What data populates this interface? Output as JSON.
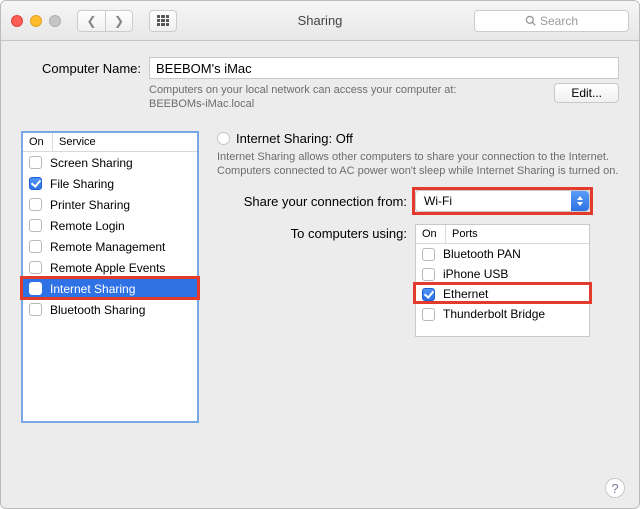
{
  "window": {
    "title": "Sharing",
    "search_placeholder": "Search"
  },
  "computer_name": {
    "label": "Computer Name:",
    "value": "BEEBOM's iMac",
    "hint1": "Computers on your local network can access your computer at:",
    "hint2": "BEEBOMs-iMac.local",
    "edit": "Edit..."
  },
  "service_table": {
    "head_on": "On",
    "head_service": "Service",
    "items": [
      {
        "label": "Screen Sharing",
        "checked": false
      },
      {
        "label": "File Sharing",
        "checked": true
      },
      {
        "label": "Printer Sharing",
        "checked": false
      },
      {
        "label": "Remote Login",
        "checked": false
      },
      {
        "label": "Remote Management",
        "checked": false
      },
      {
        "label": "Remote Apple Events",
        "checked": false
      },
      {
        "label": "Internet Sharing",
        "checked": false,
        "selected": true,
        "highlight": true
      },
      {
        "label": "Bluetooth Sharing",
        "checked": false
      }
    ]
  },
  "detail": {
    "title": "Internet Sharing: Off",
    "description": "Internet Sharing allows other computers to share your connection to the Internet. Computers connected to AC power won't sleep while Internet Sharing is turned on.",
    "share_from_label": "Share your connection from:",
    "share_from_value": "Wi-Fi",
    "to_label": "To computers using:",
    "ports_head_on": "On",
    "ports_head_ports": "Ports",
    "ports": [
      {
        "label": "Bluetooth PAN",
        "checked": false
      },
      {
        "label": "iPhone USB",
        "checked": false
      },
      {
        "label": "Ethernet",
        "checked": true,
        "highlight": true
      },
      {
        "label": "Thunderbolt Bridge",
        "checked": false
      }
    ]
  },
  "help": "?"
}
